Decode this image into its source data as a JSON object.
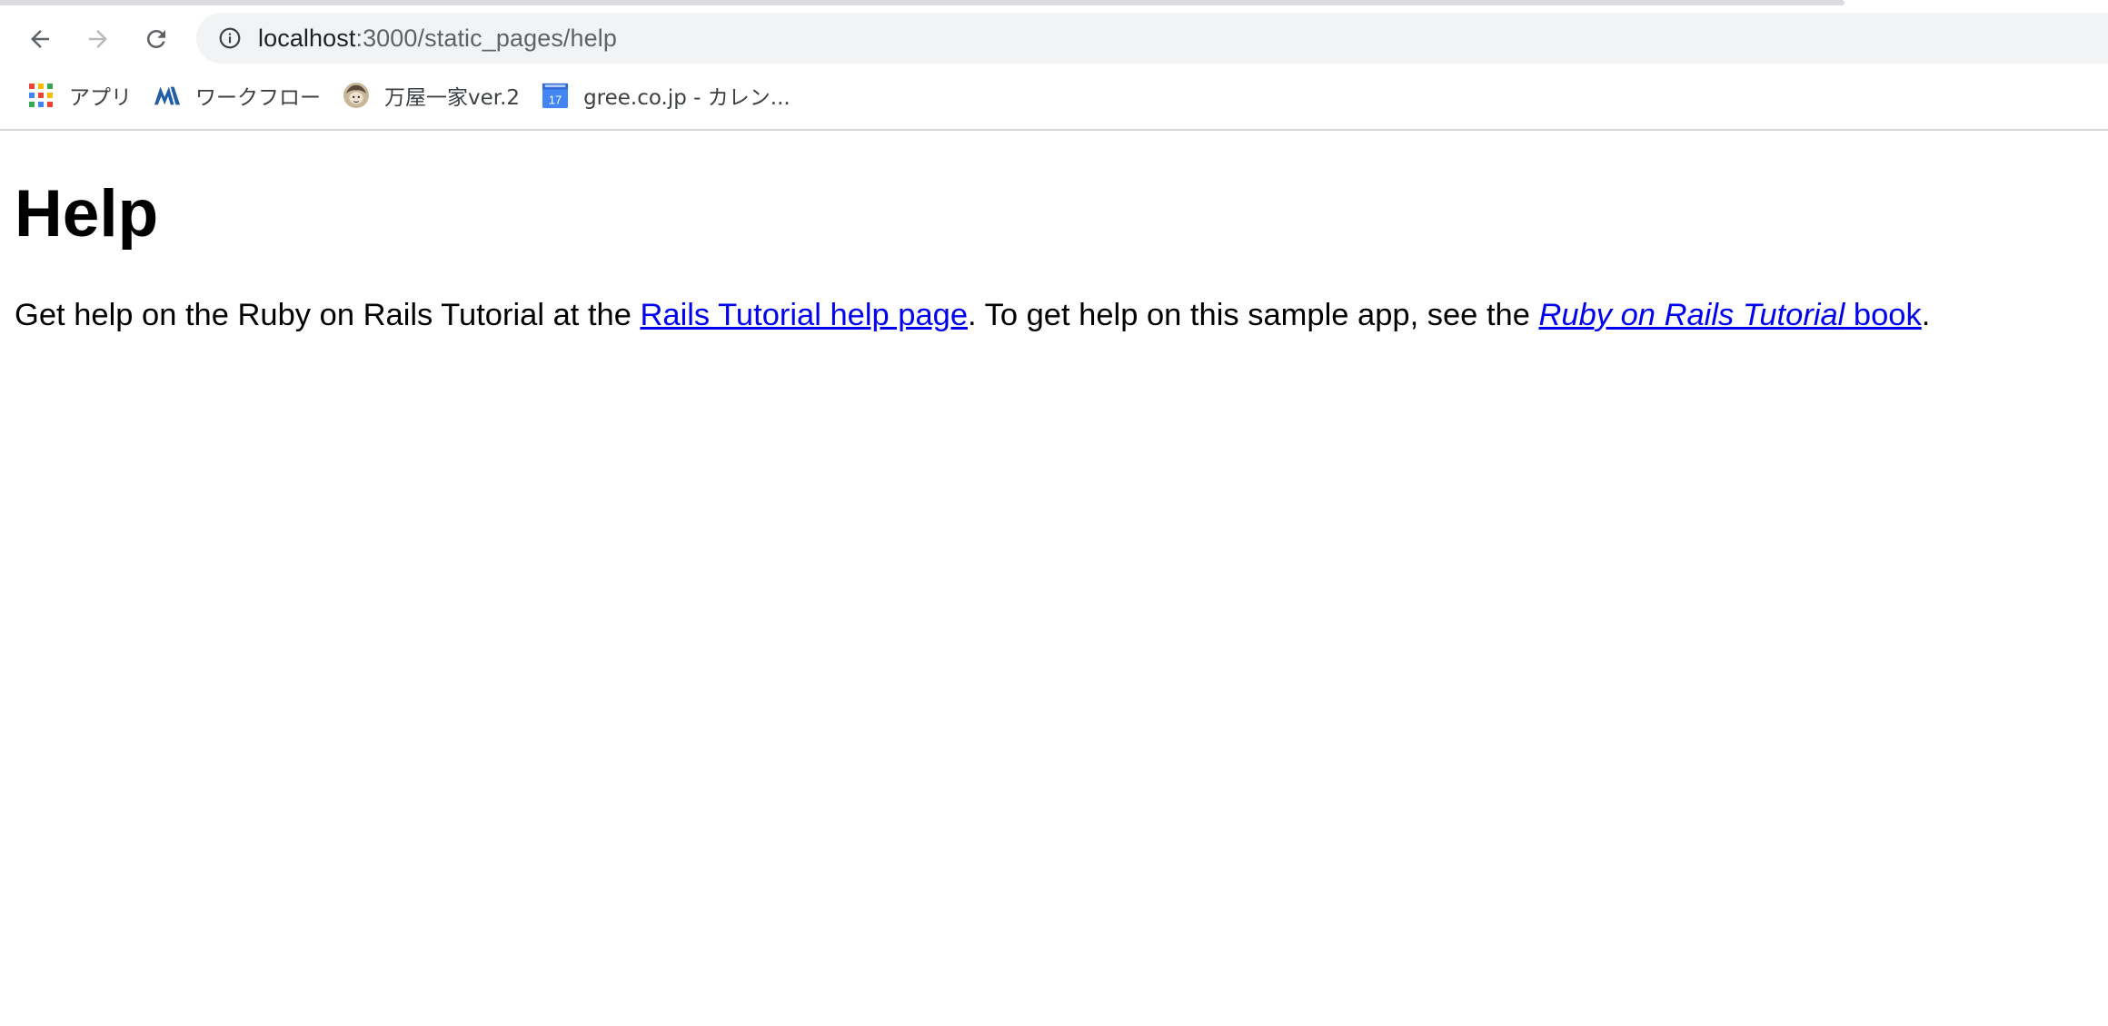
{
  "browser": {
    "url_host": "localhost",
    "url_path": ":3000/static_pages/help",
    "icons": {
      "back": "back-arrow-icon",
      "forward": "forward-arrow-icon",
      "reload": "reload-icon",
      "info": "info-icon"
    },
    "bookmarks": [
      {
        "label": "アプリ",
        "icon": "apps-grid-icon"
      },
      {
        "label": "ワークフロー",
        "icon": "workflow-logo-icon"
      },
      {
        "label": "万屋一家ver.2",
        "icon": "avatar-icon"
      },
      {
        "label": "gree.co.jp - カレン...",
        "icon": "calendar-icon",
        "icon_text": "17"
      }
    ]
  },
  "page": {
    "heading": "Help",
    "text_1": "Get help on the Ruby on Rails Tutorial at the ",
    "link_1": "Rails Tutorial help page",
    "text_2": ". To get help on this sample app, see the ",
    "link_2_italic": "Ruby on Rails Tutorial",
    "link_2_rest": " book",
    "text_3": "."
  },
  "colors": {
    "link": "#0000ee",
    "omnibox_bg": "#f1f3f4",
    "toolbar_icon": "#5f6368"
  }
}
